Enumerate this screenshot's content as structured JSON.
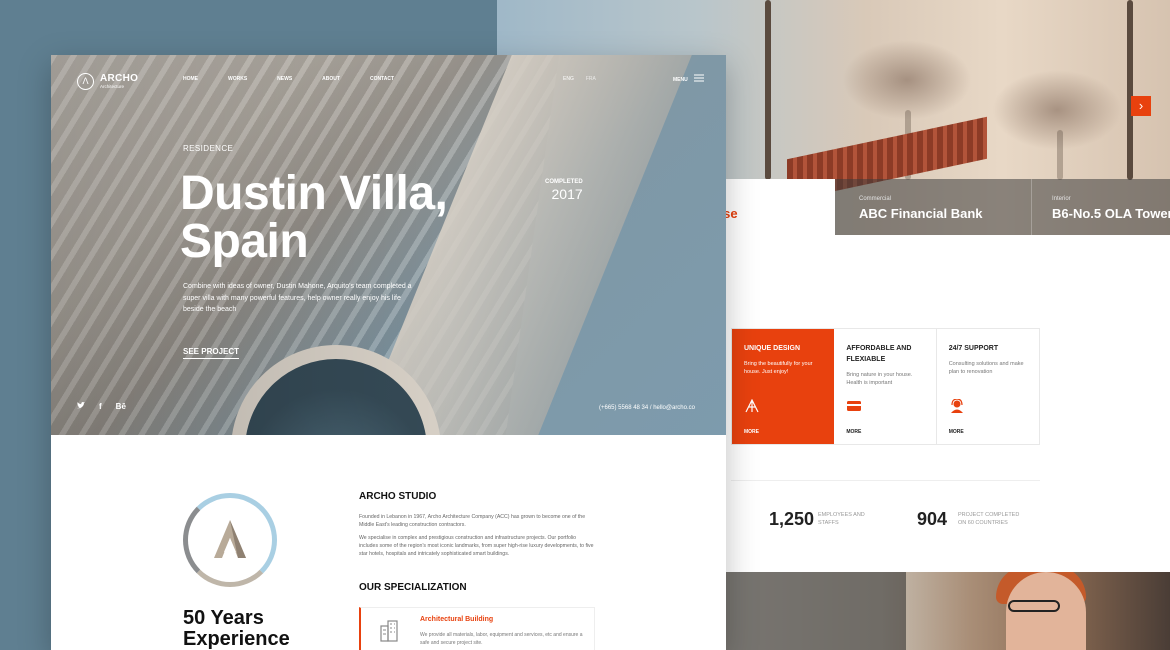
{
  "accent_color": "#e8410e",
  "back_page": {
    "projects": [
      {
        "category": "",
        "title": "re House"
      },
      {
        "category": "Commercial",
        "title": "ABC Financial Bank"
      },
      {
        "category": "Interior",
        "title": "B6-No.5 OLA Tower"
      }
    ],
    "next_icon": "chevron-right-icon",
    "features": [
      {
        "title": "UNIQUE DESIGN",
        "desc": "Bring the beautifully for your house. Just enjoy!",
        "icon": "drafting-tools-icon",
        "more": "MORE"
      },
      {
        "title": "AFFORDABLE AND FLEXIABLE",
        "desc": "Bring nature in your house. Health is important",
        "icon": "credit-card-icon",
        "more": "MORE"
      },
      {
        "title": "24/7 SUPPORT",
        "desc": "Consulting solutions and make plan to renovation",
        "icon": "support-agent-icon",
        "more": "MORE"
      }
    ],
    "stats": [
      {
        "value": "1,250",
        "label": "EMPLOYEES AND STAFFS"
      },
      {
        "value": "904",
        "label": "PROJECT COMPLETED ON 60 COUNTRIES"
      }
    ]
  },
  "header": {
    "brand": "ARCHO",
    "brand_sub": "Architecture",
    "nav": [
      "HOME",
      "WORKS",
      "NEWS",
      "ABOUT",
      "CONTACT"
    ],
    "languages": [
      "ENG",
      "FRA"
    ],
    "menu_label": "MENU"
  },
  "hero": {
    "eyebrow": "RESIDENCE",
    "title_line1": "Dustin Villa,",
    "title_line2": "Spain",
    "completed_label": "COMPLETED",
    "completed_year": "2017",
    "description": "Combine with ideas of owner, Dustin Mahone, Arquito's team completed a super villa with many powerful features, help owner really enjoy his life beside the beach",
    "cta": "SEE PROJECT",
    "social": [
      "twitter-icon",
      "facebook-icon",
      "behance-icon"
    ],
    "social_labels": [
      "t",
      "f",
      "Bē"
    ],
    "contact": "(+665) 5568 48 34  /  hello@archo.co"
  },
  "about": {
    "years": "50 Years Experience",
    "studio_heading": "ARCHO STUDIO",
    "studio_p1": "Founded in Lebanon in 1967, Archo Architecture Company (ACC) has grown to become one of the Middle East's leading construction contractors.",
    "studio_p2": "We specialise in complex and prestigious construction and infrastructure projects. Our portfolio includes some of the region's most iconic landmarks, from super high-rise luxury developments, to five star hotels, hospitals and intricately sophisticated smart buildings.",
    "spec_heading": "OUR SPECIALIZATION",
    "spec_card": {
      "title": "Architectural Building",
      "desc": "We provide all materials, labor, equipment and services, etc and ensure a safe and secure project site.",
      "icon": "building-icon"
    }
  }
}
